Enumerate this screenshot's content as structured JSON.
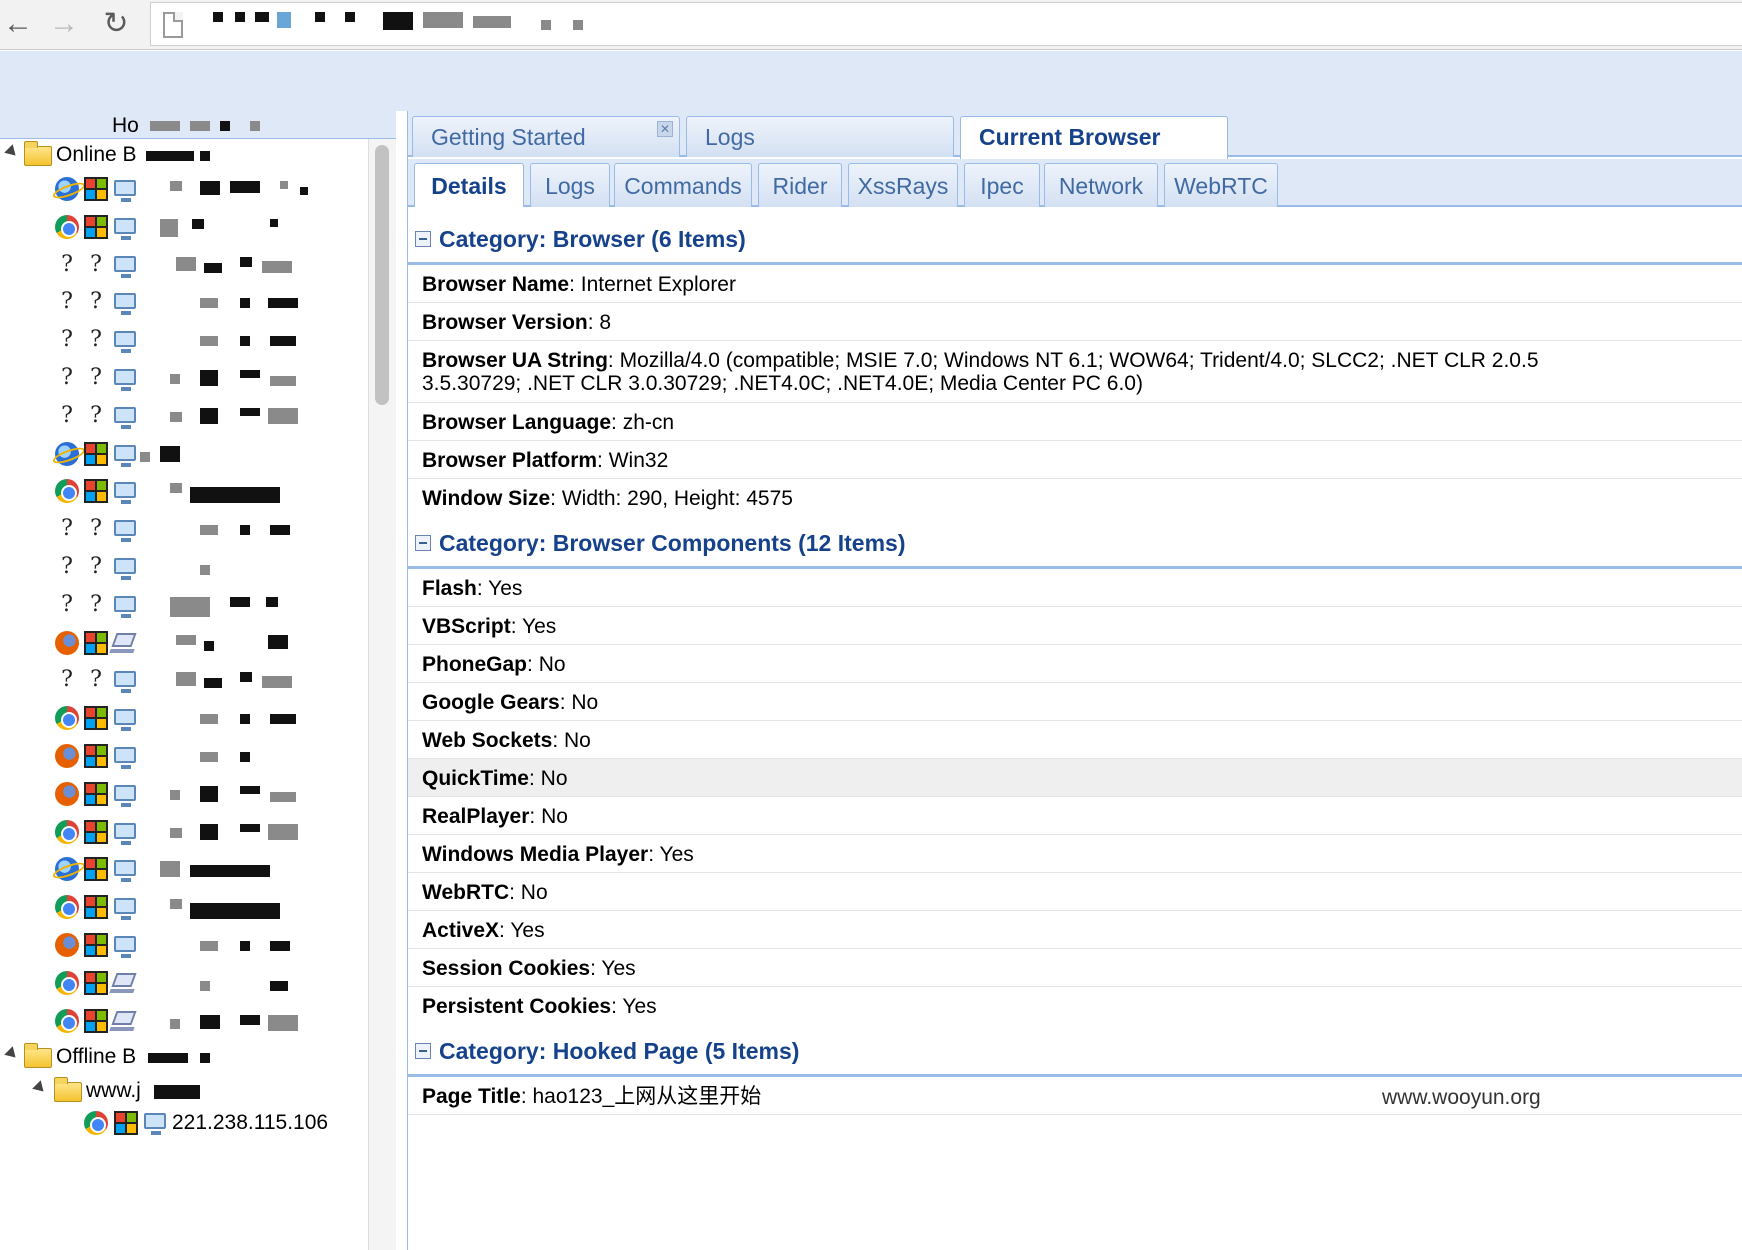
{
  "browser": {
    "back_icon": "back-arrow-icon",
    "forward_icon": "forward-arrow-icon",
    "reload_icon": "reload-icon",
    "page_icon": "page-icon"
  },
  "left_panel": {
    "header_title": "Ho",
    "online_folder": "Online B",
    "offline_folder": "Offline B",
    "offline_child": "www.j",
    "offline_partial_ip": "221.238.115.106",
    "rows": [
      {
        "browser": "ie",
        "os": "windows",
        "device": "desktop"
      },
      {
        "browser": "chrome",
        "os": "windows",
        "device": "desktop"
      },
      {
        "browser": "unknown",
        "os": "unknown",
        "device": "desktop"
      },
      {
        "browser": "unknown",
        "os": "unknown",
        "device": "desktop"
      },
      {
        "browser": "unknown",
        "os": "unknown",
        "device": "desktop"
      },
      {
        "browser": "unknown",
        "os": "unknown",
        "device": "desktop"
      },
      {
        "browser": "unknown",
        "os": "unknown",
        "device": "desktop"
      },
      {
        "browser": "ie",
        "os": "windows",
        "device": "desktop"
      },
      {
        "browser": "chrome",
        "os": "windows",
        "device": "desktop"
      },
      {
        "browser": "unknown",
        "os": "unknown",
        "device": "desktop"
      },
      {
        "browser": "unknown",
        "os": "unknown",
        "device": "desktop"
      },
      {
        "browser": "unknown",
        "os": "unknown",
        "device": "desktop"
      },
      {
        "browser": "firefox",
        "os": "windows",
        "device": "laptop"
      },
      {
        "browser": "unknown",
        "os": "unknown",
        "device": "desktop"
      },
      {
        "browser": "chrome",
        "os": "windows",
        "device": "desktop"
      },
      {
        "browser": "firefox",
        "os": "windows",
        "device": "desktop"
      },
      {
        "browser": "firefox",
        "os": "windows",
        "device": "desktop"
      },
      {
        "browser": "chrome",
        "os": "windows",
        "device": "desktop"
      },
      {
        "browser": "ie",
        "os": "windows",
        "device": "desktop"
      },
      {
        "browser": "chrome",
        "os": "windows",
        "device": "desktop"
      },
      {
        "browser": "firefox",
        "os": "windows",
        "device": "desktop"
      },
      {
        "browser": "chrome",
        "os": "windows",
        "device": "laptop"
      },
      {
        "browser": "chrome",
        "os": "windows",
        "device": "laptop"
      }
    ]
  },
  "tabs_top": [
    {
      "label": "Getting Started",
      "closable": true
    },
    {
      "label": "Logs",
      "closable": false
    },
    {
      "label": "Current Browser",
      "closable": false,
      "active": true
    }
  ],
  "tabs_sub": [
    {
      "label": "Details",
      "active": true
    },
    {
      "label": "Logs"
    },
    {
      "label": "Commands"
    },
    {
      "label": "Rider"
    },
    {
      "label": "XssRays"
    },
    {
      "label": "Ipec"
    },
    {
      "label": "Network"
    },
    {
      "label": "WebRTC"
    }
  ],
  "categories": [
    {
      "title": "Category: Browser (6 Items)",
      "items": [
        {
          "label": "Browser Name",
          "value": "Internet Explorer"
        },
        {
          "label": "Browser Version",
          "value": "8"
        },
        {
          "label": "Browser UA String",
          "value": "Mozilla/4.0 (compatible; MSIE 7.0; Windows NT 6.1; WOW64; Trident/4.0; SLCC2; .NET CLR 2.0.5",
          "value2": "3.5.30729; .NET CLR 3.0.30729; .NET4.0C; .NET4.0E; Media Center PC 6.0)"
        },
        {
          "label": "Browser Language",
          "value": "zh-cn"
        },
        {
          "label": "Browser Platform",
          "value": "Win32"
        },
        {
          "label": "Window Size",
          "value": "Width: 290, Height: 4575"
        }
      ]
    },
    {
      "title": "Category: Browser Components (12 Items)",
      "items": [
        {
          "label": "Flash",
          "value": "Yes"
        },
        {
          "label": "VBScript",
          "value": "Yes"
        },
        {
          "label": "PhoneGap",
          "value": "No"
        },
        {
          "label": "Google Gears",
          "value": "No"
        },
        {
          "label": "Web Sockets",
          "value": "No"
        },
        {
          "label": "QuickTime",
          "value": "No",
          "hover": true
        },
        {
          "label": "RealPlayer",
          "value": "No"
        },
        {
          "label": "Windows Media Player",
          "value": "Yes"
        },
        {
          "label": "WebRTC",
          "value": "No"
        },
        {
          "label": "ActiveX",
          "value": "Yes"
        },
        {
          "label": "Session Cookies",
          "value": "Yes"
        },
        {
          "label": "Persistent Cookies",
          "value": "Yes"
        }
      ]
    },
    {
      "title": "Category: Hooked Page (5 Items)",
      "items": [
        {
          "label": "Page Title",
          "value": "hao123_上网从这里开始"
        }
      ]
    }
  ],
  "watermark": "www.wooyun.org",
  "colors": {
    "accent": "#15428b",
    "tab_bg": "#dfe8f6",
    "border": "#99bbe8"
  }
}
